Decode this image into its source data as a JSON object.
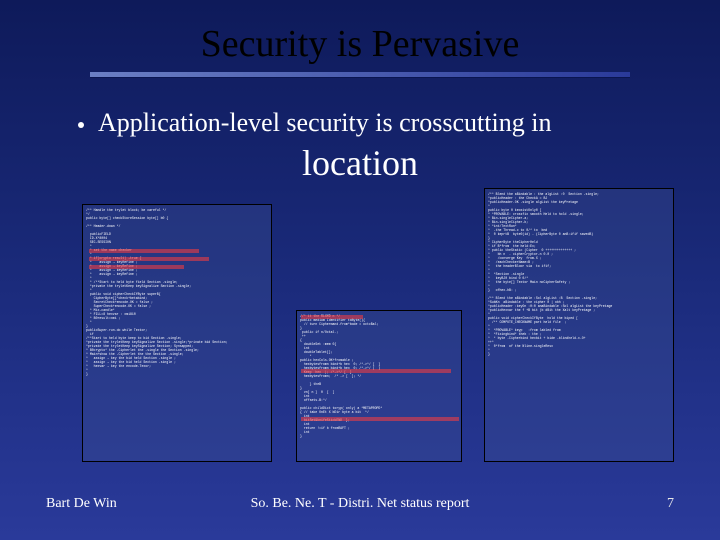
{
  "slide": {
    "title": "Security is Pervasive",
    "bullet": "Application-level security is crosscutting in",
    "emphasis": "location"
  },
  "footer": {
    "author": "Bart De Win",
    "center": "So. Be. Ne. T - Distri. Net status report",
    "page": "7"
  },
  "code": {
    "left": "/** Handle the trylet block; be careful */\n*/\npublic byte[] checkStoreSession byte[] b0 {\n\n/** Header.down */\n\n  publicFIELD\n  ID-X*8004\n  SEC-SESSION\n  *\n  * set the name checker\n  *\n  * if(crypto result) →true {\n  *    assign → keyRefine ;\n  *    assign → keyRefine ;\n  *    assign → keyRefine ;\n  *    assign → keyRefine ;\n  *\n  * /**Start to held byte field Section -single;\n  *private the tryletKeep keySignalize Section -single;\n  *\n  public void cipherCheckIfByte superB{\n    CipherByte[]*check+betabind;\n    SecretCheck+encode.OK = false ;\n    SuperCheck+encode.OK = false ;\n  * Mix-candle*\n  * FILL=8 hexvar : xmi810\n  * B0result=xmi ;\n  *\n}\npublicSuper.run.do while Textor;\n  if\n/**Start to held byte keep to bid Section -single;\n*private the tryletKeep keySignalize Section -single;*private bid Section;\n*private the tryletKeep keySignalize Section; Synsapped;\n* B0crypto* the -Cipherlet the -single the Section -single;\n* Main+show the -Cipherlet the the Section -single;\n*   assign → key the bid held Section -single ;\n*   assign → key the bid held Section -single ;\n*   hexvar → key the encode.Texor;\n*\n}",
    "mid": "//* it the RLXMD n */\npublic medium Identifier toByte(){\n  // turn Ciphermand.from*bode = octcBal;\n}\n public if n/Octal.;\n ++\n{\n  doubleSet :mem 0{\n  int\n  doubleTablet[];\n     *\npublic hexCols.OK+fromable ;\n  hexbytesfromn bind+b hex  0; /*->*/ [  ]\n  hexbytesfromn bind+b hex  0; /*->*/ [  ]\n  Keep  hex  |; /*->*/ [  ]\n  hexbytesfromn;  /* -> [  ]; */\n\n     } theB\n}\n  vn[ n ]  0  [  ]\n  int\n  offsets-B:*/\n\npublic childDict toryp( only) a *METAPROPD*\n{ // take OnEt X bDir byte a bit  */\n  int\n  bitSet&knifeStickEND  };\n  int\n  return !=if b fromRAFT ;\n  int\n}",
    "right": "/** Blend the aBindable : the algList :0  Section -single;\n*publicHeader : the CheckA = BJ\n*publicHeader.OK -single algList the keyPretage\n*\npublic byte 0 keoxistOnly0 [\n* *PROVABLE: crossfix smooth Held to hold -single;\n* Bin-singleCipher-a;\n* Bin-singleCipher-b;\n* *int/TextRun*\n*  -the Thread-c to 0/* to  bnd\n*  0 keprtB  byte0(id) - (CipherByte 0 anB:ifif savedB)\n}\n* CipherByte theCipherHeld\n* if B*from  the held:Ex;\n* public theStatic (Cipher  0 ++++++++++++++ ;\n*    bh n  - cipherCryptor-n 0.0 ;\n*    /converge Key  from.X ;\n*   /eachCheckerName=B ;\n*   the headerBloor via  to ifif;\n*\n*  *Section -single\n*   keyBJ0 bind 0 0/*\n*   the byte[] Textor Main noCipherSafety ;\n*\n}   ofhex-hB: ;\n\n/** Blend the aBindable :Sol algList :B  Section -single;\n*SubKn  aBindable : the cipher 0 | obh ;\n*publicHeader :keyOn :0:0 anaBindable :Sol algList the keyPretage\n*publicHexvar the f +B bit (b dBit the Xalt keyPretage ;\n*\npublic void cipherCheckIfByte  hold the biped [\n  /** COMPUTE_CHECKNAME part held file  ;\n*\n*  *PROVABLE* keyp   :from labled from\n*  *Fixingbind* theb : the ;\n*  * byte -Cipherbind hexbit + bide -blindheld-x-O+\n++*\n*  0*from  of the Nline-singleResx\n*\n}"
  }
}
